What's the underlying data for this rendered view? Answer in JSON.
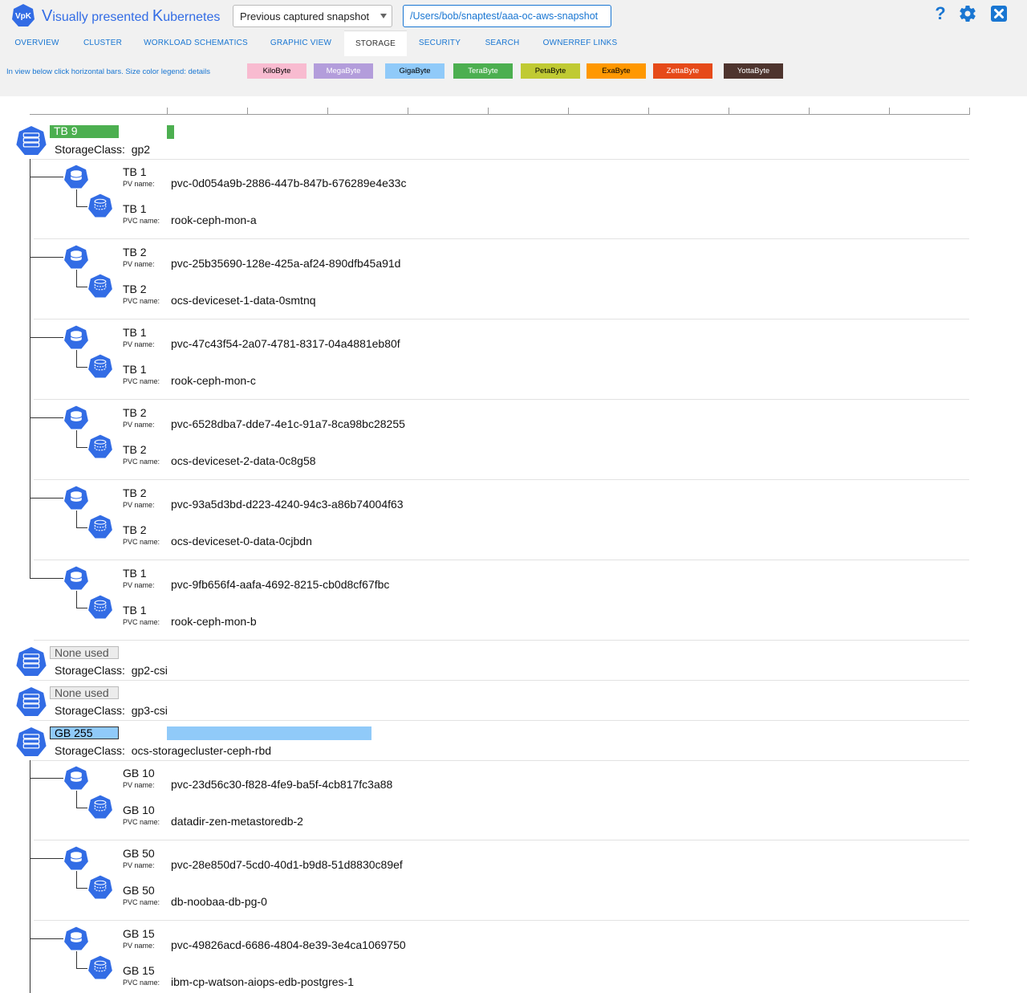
{
  "app": {
    "logo_text": "VpK",
    "title_parts": [
      {
        "t": "V",
        "big": true
      },
      {
        "t": "isually presented ",
        "big": false
      },
      {
        "t": "K",
        "big": true
      },
      {
        "t": "ubernetes",
        "big": false
      }
    ]
  },
  "toolbar": {
    "snapshot_select_value": "Previous captured snapshot",
    "directory_value": "/Users/bob/snaptest/aaa-oc-aws-snapshot",
    "help_label": "?"
  },
  "tabs": [
    {
      "label": "OVERVIEW",
      "active": false
    },
    {
      "label": "CLUSTER",
      "active": false
    },
    {
      "label": "WORKLOAD SCHEMATICS",
      "active": false
    },
    {
      "label": "GRAPHIC VIEW",
      "active": false
    },
    {
      "label": "STORAGE",
      "active": true
    },
    {
      "label": "SECURITY",
      "active": false
    },
    {
      "label": "SEARCH",
      "active": false
    },
    {
      "label": "OWNERREF LINKS",
      "active": false
    }
  ],
  "legend": {
    "text": "In view below click horizontal bars. Size color legend: details",
    "items": [
      {
        "label": "KiloByte",
        "bg": "#f8bbd0",
        "fg": "#000000"
      },
      {
        "label": "MegaByte",
        "bg": "#b39ddb",
        "fg": "#ffffff"
      },
      {
        "label": "GigaByte",
        "bg": "#90caf9",
        "fg": "#000000"
      },
      {
        "label": "TeraByte",
        "bg": "#4caf50",
        "fg": "#ffffff"
      },
      {
        "label": "PetaByte",
        "bg": "#c0ca33",
        "fg": "#000000"
      },
      {
        "label": "ExaByte",
        "bg": "#ff9800",
        "fg": "#000000"
      },
      {
        "label": "ZettaByte",
        "bg": "#e64a19",
        "fg": "#ffffff"
      },
      {
        "label": "YottaByte",
        "bg": "#4e342e",
        "fg": "#ffffff"
      }
    ]
  },
  "storage": {
    "sc_prefix": "StorageClass:",
    "pv_key": "PV name:",
    "pvc_key": "PVC name:",
    "classes": [
      {
        "size": "TB 9",
        "name": "gp2",
        "unit": "TeraByte",
        "bar_fraction": 0.009,
        "volumes": [
          {
            "pv_size": "TB 1",
            "pv_name": "pvc-0d054a9b-2886-447b-847b-676289e4e33c",
            "pvc_size": "TB 1",
            "pvc_name": "rook-ceph-mon-a"
          },
          {
            "pv_size": "TB 2",
            "pv_name": "pvc-25b35690-128e-425a-af24-890dfb45a91d",
            "pvc_size": "TB 2",
            "pvc_name": "ocs-deviceset-1-data-0smtnq"
          },
          {
            "pv_size": "TB 1",
            "pv_name": "pvc-47c43f54-2a07-4781-8317-04a4881eb80f",
            "pvc_size": "TB 1",
            "pvc_name": "rook-ceph-mon-c"
          },
          {
            "pv_size": "TB 2",
            "pv_name": "pvc-6528dba7-dde7-4e1c-91a7-8ca98bc28255",
            "pvc_size": "TB 2",
            "pvc_name": "ocs-deviceset-2-data-0c8g58"
          },
          {
            "pv_size": "TB 2",
            "pv_name": "pvc-93a5d3bd-d223-4240-94c3-a86b74004f63",
            "pvc_size": "TB 2",
            "pvc_name": "ocs-deviceset-0-data-0cjbdn"
          },
          {
            "pv_size": "TB 1",
            "pv_name": "pvc-9fb656f4-aafa-4692-8215-cb0d8cf67fbc",
            "pvc_size": "TB 1",
            "pvc_name": "rook-ceph-mon-b"
          }
        ]
      },
      {
        "size": "None used",
        "name": "gp2-csi",
        "unit": "none",
        "bar_fraction": 0,
        "volumes": []
      },
      {
        "size": "None used",
        "name": "gp3-csi",
        "unit": "none",
        "bar_fraction": 0,
        "volumes": []
      },
      {
        "size": "GB 255",
        "name": "ocs-storagecluster-ceph-rbd",
        "unit": "GigaByte",
        "bar_fraction": 0.255,
        "volumes": [
          {
            "pv_size": "GB 10",
            "pv_name": "pvc-23d56c30-f828-4fe9-ba5f-4cb817fc3a88",
            "pvc_size": "GB 10",
            "pvc_name": "datadir-zen-metastoredb-2"
          },
          {
            "pv_size": "GB 50",
            "pv_name": "pvc-28e850d7-5cd0-40d1-b9d8-51d8830c89ef",
            "pvc_size": "GB 50",
            "pvc_name": "db-noobaa-db-pg-0"
          },
          {
            "pv_size": "GB 15",
            "pv_name": "pvc-49826acd-6686-4804-8e39-3e4ca1069750",
            "pvc_size": "GB 15",
            "pvc_name": "ibm-cp-watson-aiops-edb-postgres-1"
          }
        ]
      }
    ]
  },
  "colors": {
    "accent": "#1976d2",
    "k8s_blue": "#326ce5",
    "terabyte": "#4caf50",
    "gigabyte": "#90caf9"
  }
}
